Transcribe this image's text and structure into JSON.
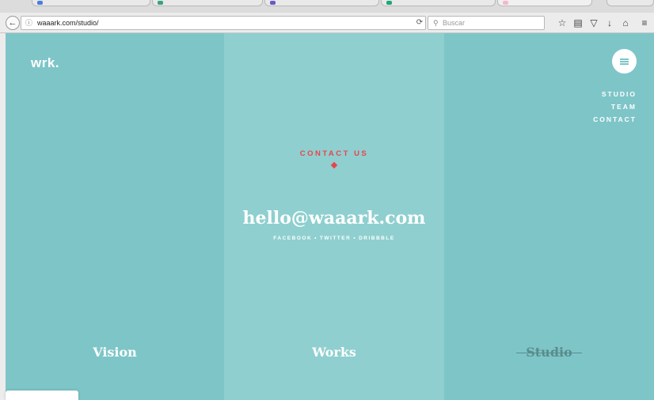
{
  "browser": {
    "url": "waaark.com/studio/",
    "search_placeholder": "Buscar",
    "icons": [
      "back-arrow-icon",
      "info-icon",
      "reload-icon",
      "search-icon",
      "star-icon",
      "reading-list-icon",
      "pocket-icon",
      "download-icon",
      "home-icon",
      "menu-icon"
    ]
  },
  "site": {
    "logo": "wrk.",
    "nav": [
      "STUDIO",
      "TEAM",
      "CONTACT"
    ],
    "contact": {
      "label": "CONTACT US",
      "email": "hello@waaark.com",
      "socials": [
        "FACEBOOK",
        "TWITTER",
        "DRIBBBLE"
      ],
      "separator": "•"
    },
    "columns": [
      "Vision",
      "Works",
      "Studio"
    ],
    "colors": {
      "teal": "#7ec5c8",
      "teal_light": "#8fcfcf",
      "accent_red": "#e8444c",
      "white": "#ffffff"
    }
  }
}
